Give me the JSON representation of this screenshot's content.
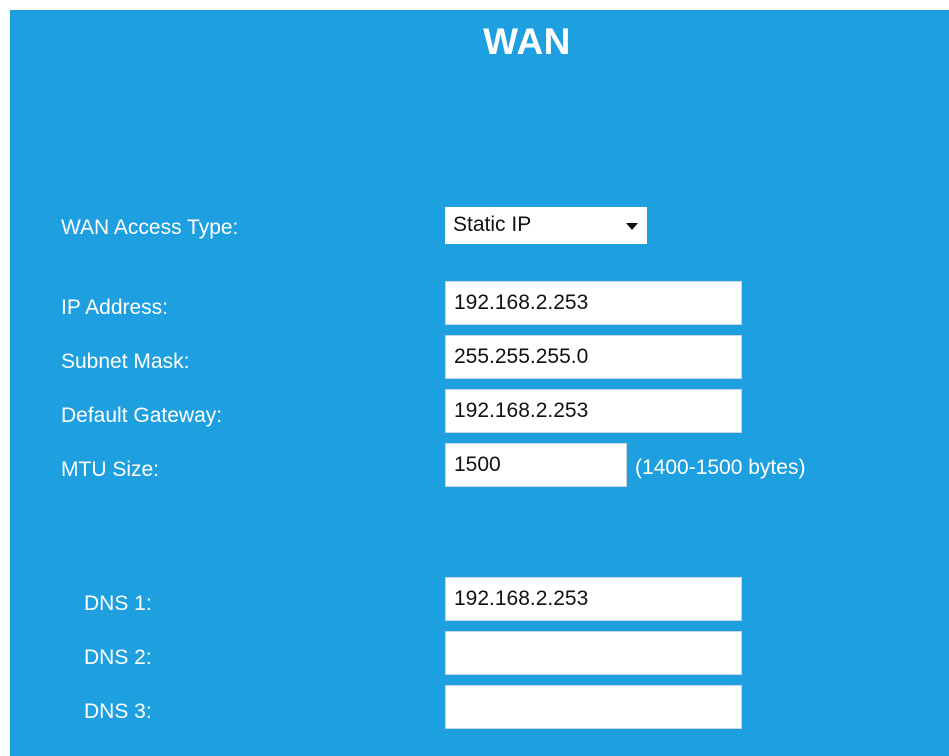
{
  "header": {
    "title": "WAN"
  },
  "access_type": {
    "label": "WAN Access Type:",
    "selected": "Static IP"
  },
  "ip": {
    "ip_address": {
      "label": "IP Address:",
      "value": "192.168.2.253"
    },
    "subnet_mask": {
      "label": "Subnet Mask:",
      "value": "255.255.255.0"
    },
    "default_gateway": {
      "label": "Default Gateway:",
      "value": "192.168.2.253"
    },
    "mtu": {
      "label": "MTU Size:",
      "value": "1500",
      "hint": "(1400-1500 bytes)"
    }
  },
  "dns": {
    "dns1": {
      "label": "DNS 1:",
      "value": "192.168.2.253"
    },
    "dns2": {
      "label": "DNS 2:",
      "value": ""
    },
    "dns3": {
      "label": "DNS 3:",
      "value": ""
    }
  },
  "colors": {
    "panel_background": "#1e9fe0",
    "text": "#ffffff"
  }
}
